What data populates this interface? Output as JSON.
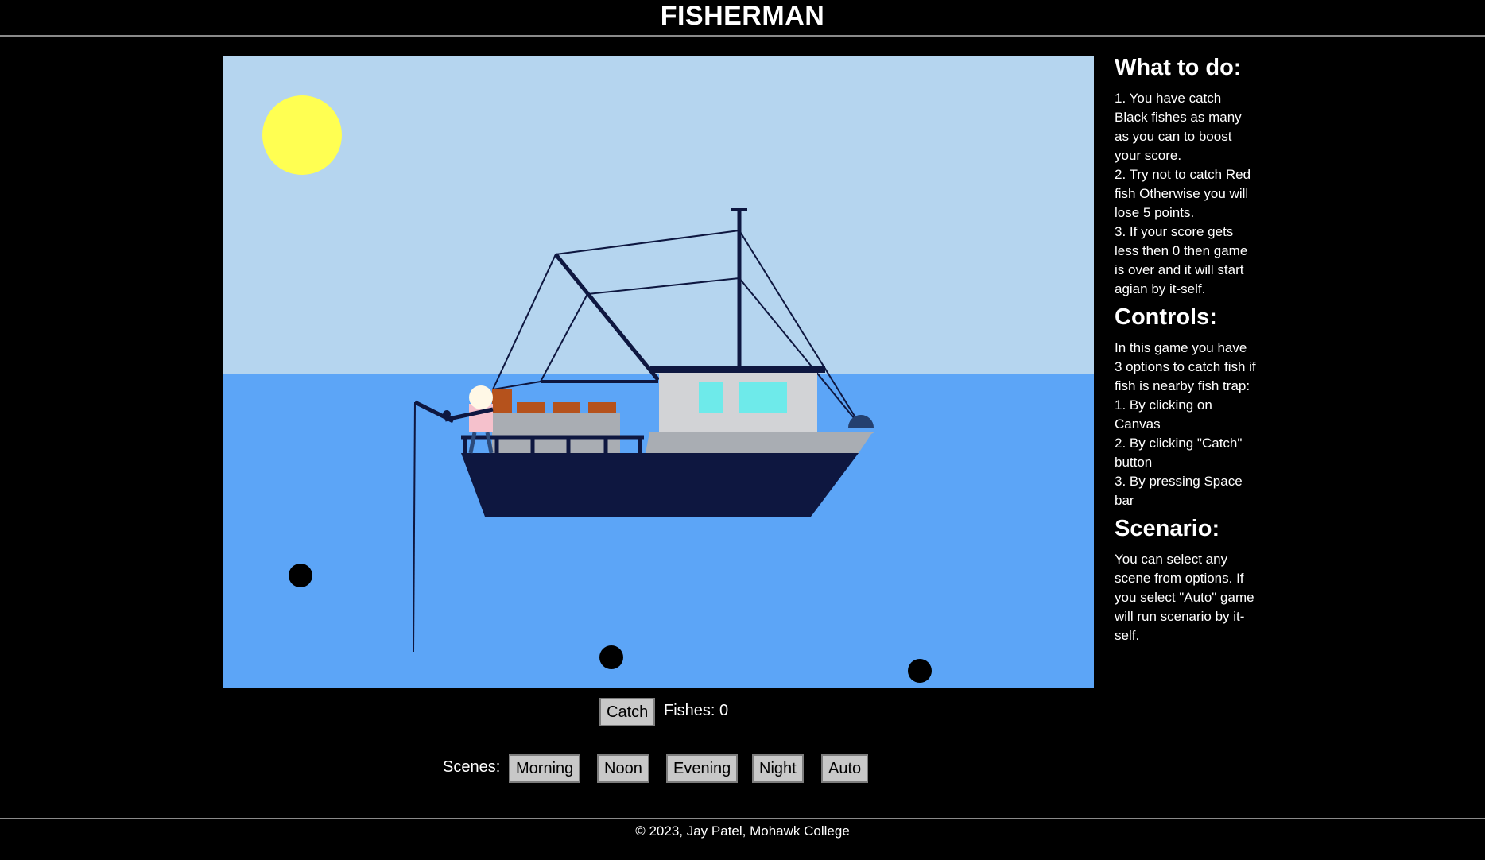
{
  "header": {
    "title": "FISHERMAN"
  },
  "game": {
    "colors": {
      "sky": "#b5d5ef",
      "sea": "#5ca5f7",
      "sun": "#ffff52",
      "hull": "#0e1740",
      "cabin": "#d2d3d6",
      "deck": "#a9adb3",
      "window": "#6eeaea",
      "crate": "#b5521c",
      "fish_black": "#000000"
    },
    "black_fish_count": 3
  },
  "controls": {
    "catch_label": "Catch",
    "score_label": "Fishes: 0",
    "scenes_label": "Scenes:",
    "scenes": [
      "Morning",
      "Noon",
      "Evening",
      "Night",
      "Auto"
    ]
  },
  "sidebar": {
    "what_to_do_title": "What to do:",
    "what_to_do": [
      "1. You have catch Black fishes as many as you can to boost your score.",
      "2. Try not to catch Red fish Otherwise you will lose 5 points.",
      "3. If your score gets less then 0 then game is over and it will start agian by it-self."
    ],
    "controls_title": "Controls:",
    "controls_intro": "In this game you have 3 options to catch fish if fish is nearby fish trap:",
    "controls_list": [
      "1. By clicking on Canvas",
      "2. By clicking \"Catch\" button",
      "3. By pressing Space bar"
    ],
    "scenario_title": "Scenario:",
    "scenario_text": "You can select any scene from options. If you select \"Auto\" game will run scenario by it-self."
  },
  "footer": {
    "text": "© 2023, Jay Patel, Mohawk College"
  }
}
